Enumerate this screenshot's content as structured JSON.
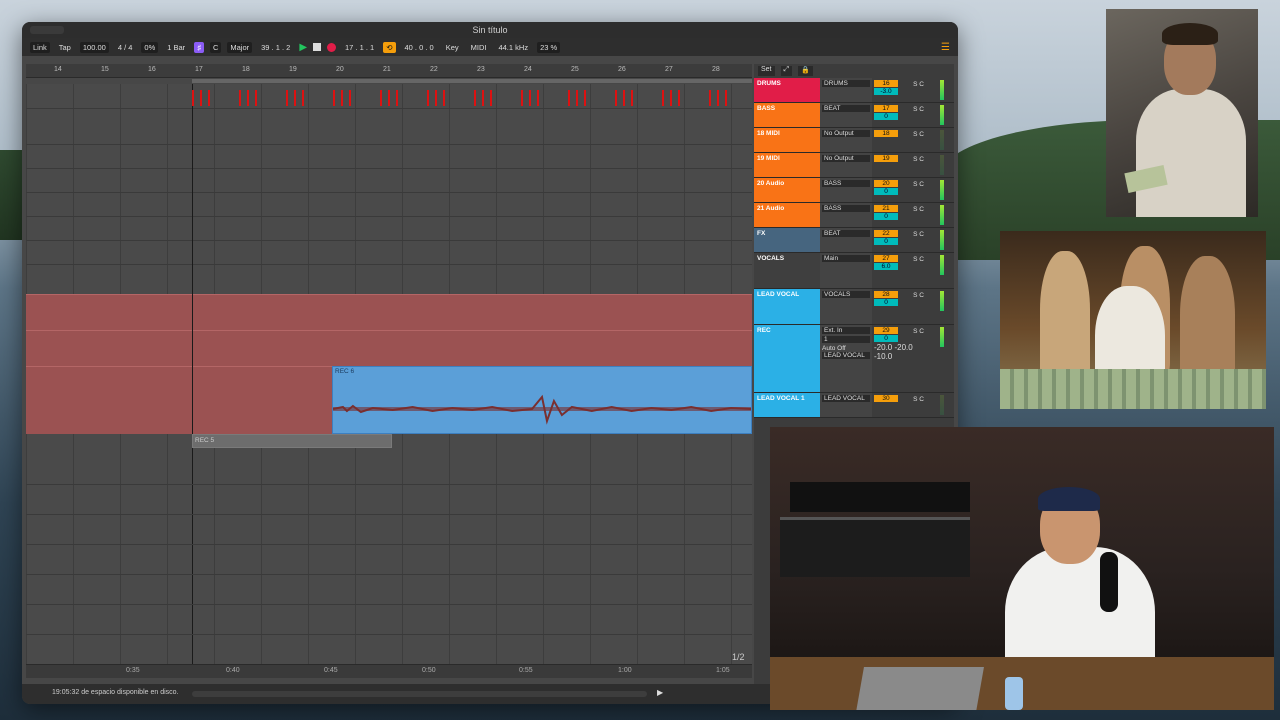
{
  "app": {
    "window_title": "Sin título",
    "status": "19:05:32 de espacio disponible en disco.",
    "page_indicator": "1/2"
  },
  "control_bar": {
    "link": "Link",
    "tap": "Tap",
    "tempo": "100.00",
    "time_sig": "4 / 4",
    "swing": "0%",
    "quantize": "1 Bar",
    "key": "C",
    "scale": "Major",
    "position": "39 .  1 .  2",
    "loop_start": "17 .  1 .  1",
    "loop_length": "40 .  0 .  0",
    "key_label": "Key",
    "midi_label": "MIDI",
    "sample_rate": "44.1 kHz",
    "cpu": "23 %"
  },
  "ruler": [
    "14",
    "15",
    "16",
    "17",
    "18",
    "19",
    "20",
    "21",
    "22",
    "23",
    "24",
    "25",
    "26",
    "27",
    "28"
  ],
  "timeline": [
    "0:35",
    "0:40",
    "0:45",
    "0:50",
    "0:55",
    "1:00",
    "1:05"
  ],
  "clips": {
    "rec_main": "REC 6",
    "rec_small": "REC 5"
  },
  "set_row": {
    "set": "Set"
  },
  "tracks": [
    {
      "name": "DRUMS",
      "route": "DRUMS",
      "num": "16",
      "vol": "-3.0",
      "color": "#e11d48"
    },
    {
      "name": "BASS",
      "route": "BEAT",
      "num": "17",
      "vol": "0",
      "color": "#f97316"
    },
    {
      "name": "18 MIDI",
      "route": "No Output",
      "num": "18",
      "vol": "",
      "color": "#f97316"
    },
    {
      "name": "19 MIDI",
      "route": "No Output",
      "num": "19",
      "vol": "",
      "color": "#f97316"
    },
    {
      "name": "20 Audio",
      "route": "BASS",
      "num": "20",
      "vol": "0",
      "color": "#f97316"
    },
    {
      "name": "21 Audio",
      "route": "BASS",
      "num": "21",
      "vol": "0",
      "color": "#f97316"
    },
    {
      "name": "FX",
      "route": "BEAT",
      "num": "22",
      "vol": "0",
      "color": "#46657f"
    },
    {
      "name": "VOCALS",
      "route": "Main",
      "num": "27",
      "vol": "6.0",
      "color": "#3f3f3f"
    },
    {
      "name": "LEAD VOCAL",
      "route": "VOCALS",
      "num": "28",
      "vol": "0",
      "color": "#2bb0e6"
    },
    {
      "name": "REC",
      "route": "Ext. In",
      "num": "29",
      "vol": "0",
      "color": "#2bb0e6"
    },
    {
      "name": "LEAD VOCAL 1",
      "route": "LEAD VOCAL",
      "num": "30",
      "vol": "",
      "color": "#2bb0e6"
    }
  ],
  "rec_track_extra": {
    "channel": "1",
    "auto": "Auto",
    "off": "Off",
    "db1": "-20.0",
    "db2": "-20.0",
    "db3": "-10.0",
    "dest": "LEAD VOCAL"
  },
  "solo_label": "S",
  "pan_center": "C",
  "inf": "-∞"
}
